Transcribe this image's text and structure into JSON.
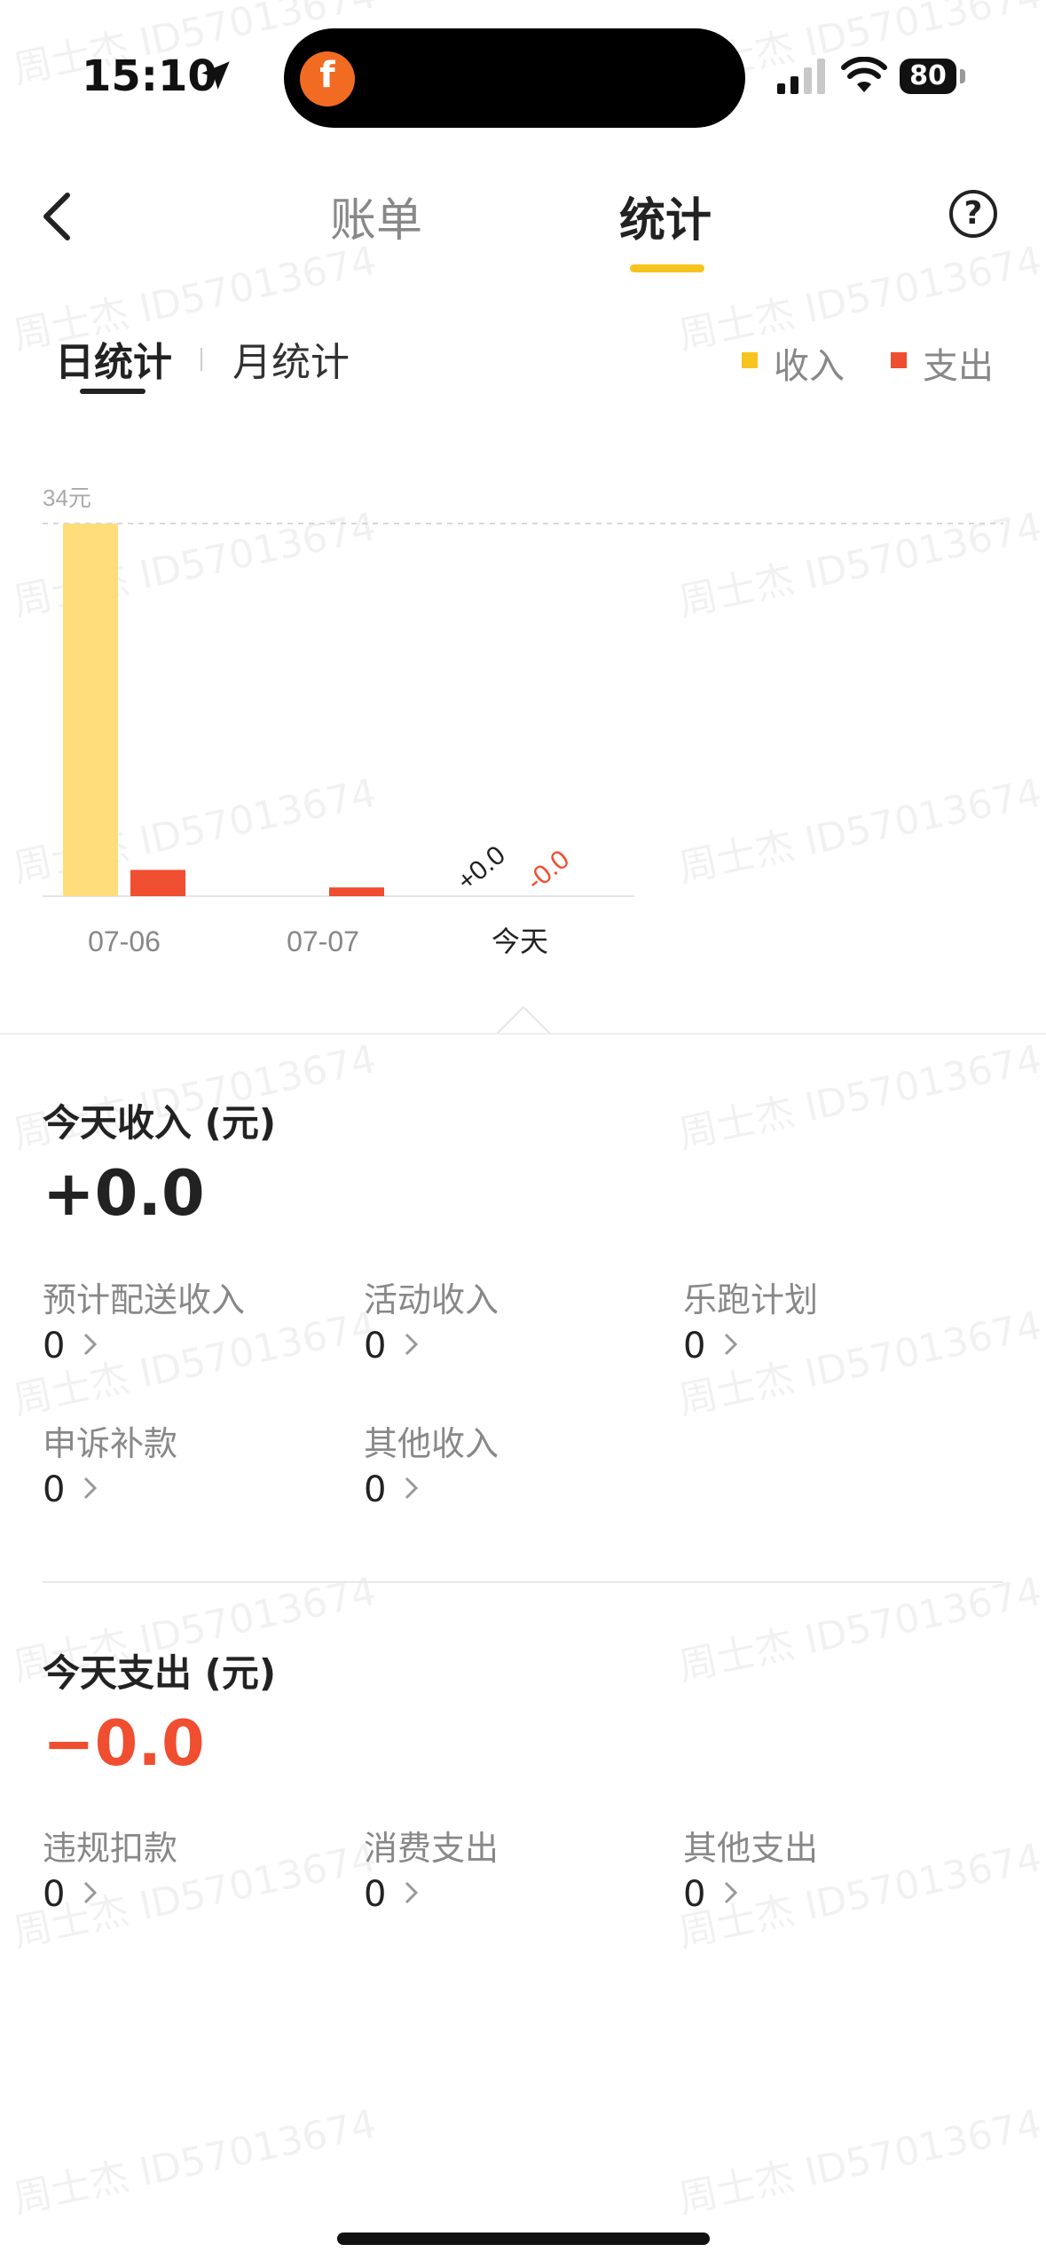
{
  "status_bar": {
    "time": "15:10",
    "battery": "80"
  },
  "header": {
    "tabs": [
      {
        "label": "账单"
      },
      {
        "label": "统计"
      }
    ],
    "active_tab": "统计"
  },
  "sub_tabs": {
    "day": "日统计",
    "month": "月统计"
  },
  "legend": {
    "income": "收入",
    "expense": "支出"
  },
  "colors": {
    "income": "#ffdd7a",
    "expense": "#f04e30",
    "accent": "#f7c31e"
  },
  "chart_data": {
    "type": "bar",
    "categories": [
      "07-06",
      "07-07",
      "今天"
    ],
    "series": [
      {
        "name": "收入",
        "values": [
          34,
          0,
          0
        ]
      },
      {
        "name": "支出",
        "values": [
          2.4,
          0.8,
          0
        ]
      }
    ],
    "y_max_label": "34元",
    "ylim": [
      0,
      34
    ],
    "data_labels": {
      "today_income": "+0.0",
      "today_expense": "-0.0"
    }
  },
  "income_section": {
    "title": "今天收入 (元)",
    "total": "+0.0",
    "items": [
      {
        "label": "预计配送收入",
        "value": "0"
      },
      {
        "label": "活动收入",
        "value": "0"
      },
      {
        "label": "乐跑计划",
        "value": "0"
      },
      {
        "label": "申诉补款",
        "value": "0"
      },
      {
        "label": "其他收入",
        "value": "0"
      }
    ]
  },
  "expense_section": {
    "title": "今天支出 (元)",
    "total": "−0.0",
    "items": [
      {
        "label": "违规扣款",
        "value": "0"
      },
      {
        "label": "消费支出",
        "value": "0"
      },
      {
        "label": "其他支出",
        "value": "0"
      }
    ]
  },
  "watermark": "周士杰 ID57013674"
}
